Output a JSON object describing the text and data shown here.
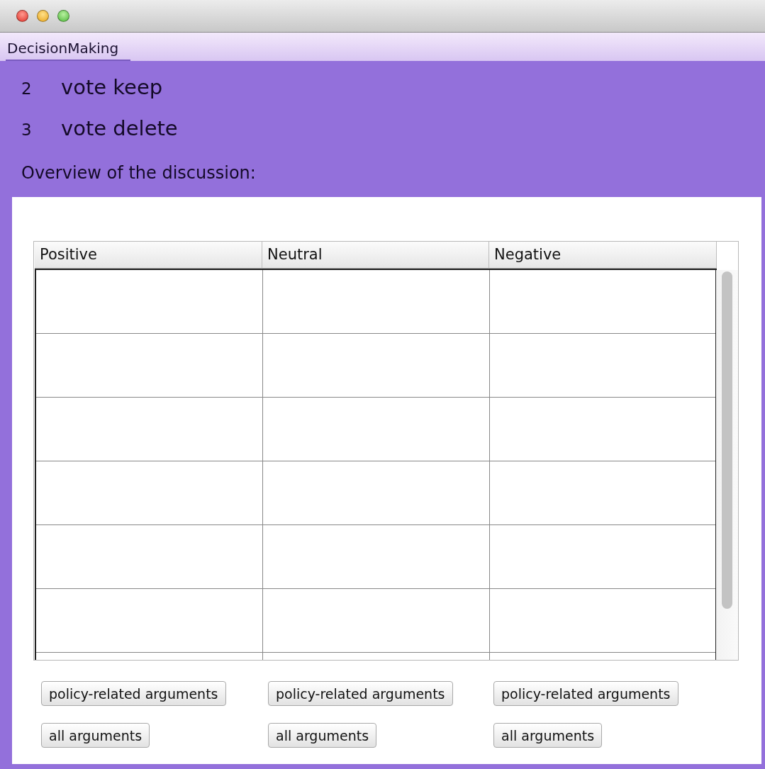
{
  "tabs": [
    {
      "label": "DecisionMaking",
      "selected": true
    }
  ],
  "votes": [
    {
      "count": "2",
      "label": "vote keep"
    },
    {
      "count": "3",
      "label": "vote delete"
    }
  ],
  "overview_label": "Overview of the discussion:",
  "table": {
    "columns": [
      "Positive",
      "Neutral",
      "Negative"
    ]
  },
  "button_columns": [
    {
      "buttons": [
        "policy-related arguments",
        "all arguments"
      ]
    },
    {
      "buttons": [
        "policy-related arguments",
        "all arguments"
      ]
    },
    {
      "buttons": [
        "policy-related arguments",
        "all arguments"
      ]
    }
  ]
}
